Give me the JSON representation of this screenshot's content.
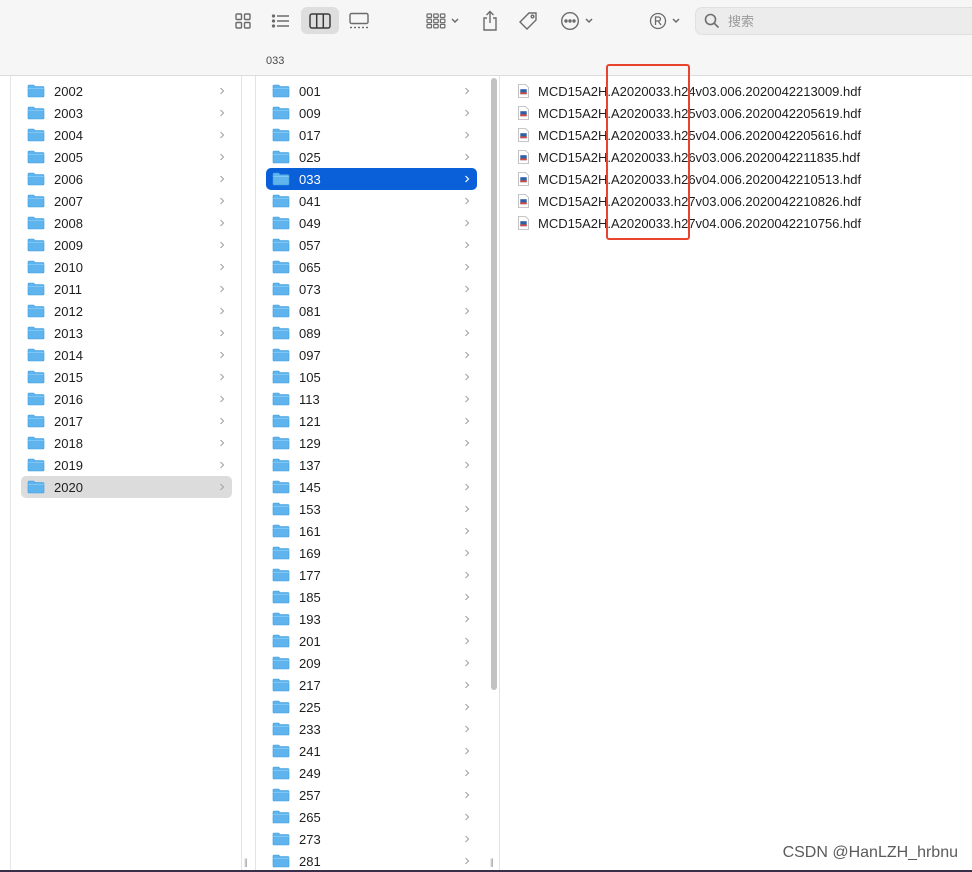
{
  "toolbar": {
    "search_placeholder": "搜索",
    "icons": {
      "view_icons": "grid-icon",
      "view_list": "list-icon",
      "view_columns": "columns-icon",
      "view_gallery": "gallery-icon",
      "group": "group-icon",
      "share": "share-icon",
      "tags": "tag-icon",
      "action": "ellipsis-icon",
      "profile": "registered-icon"
    }
  },
  "path_title": "033",
  "years": [
    "2002",
    "2003",
    "2004",
    "2005",
    "2006",
    "2007",
    "2008",
    "2009",
    "2010",
    "2011",
    "2012",
    "2013",
    "2014",
    "2015",
    "2016",
    "2017",
    "2018",
    "2019",
    "2020"
  ],
  "selected_year": "2020",
  "days": [
    "001",
    "009",
    "017",
    "025",
    "033",
    "041",
    "049",
    "057",
    "065",
    "073",
    "081",
    "089",
    "097",
    "105",
    "113",
    "121",
    "129",
    "137",
    "145",
    "153",
    "161",
    "169",
    "177",
    "185",
    "193",
    "201",
    "209",
    "217",
    "225",
    "233",
    "241",
    "249",
    "257",
    "265",
    "273",
    "281"
  ],
  "selected_day": "033",
  "files": [
    "MCD15A2H.A2020033.h24v03.006.2020042213009.hdf",
    "MCD15A2H.A2020033.h25v03.006.2020042205619.hdf",
    "MCD15A2H.A2020033.h25v04.006.2020042205616.hdf",
    "MCD15A2H.A2020033.h26v03.006.2020042211835.hdf",
    "MCD15A2H.A2020033.h26v04.006.2020042210513.hdf",
    "MCD15A2H.A2020033.h27v03.006.2020042210826.hdf",
    "MCD15A2H.A2020033.h27v04.006.2020042210756.hdf"
  ],
  "colors": {
    "selection_blue": "#0a60d8",
    "selection_gray": "#dcdcdc",
    "folder_blue": "#5fb4ee",
    "highlight_red": "#e8432f"
  },
  "watermark": "CSDN @HanLZH_hrbnu"
}
